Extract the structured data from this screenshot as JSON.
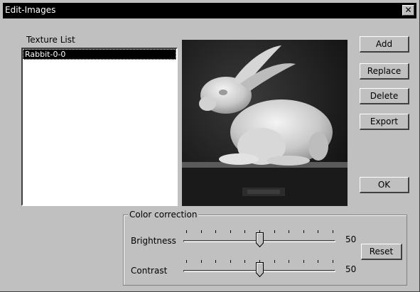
{
  "window": {
    "title": "Edit-Images",
    "close_label": "✕"
  },
  "texture_list": {
    "label": "Texture List",
    "items": [
      "Rabbit-0-0"
    ],
    "selected_index": 0
  },
  "buttons": {
    "add": "Add",
    "replace": "Replace",
    "delete": "Delete",
    "export": "Export",
    "ok": "OK",
    "reset": "Reset"
  },
  "color_correction": {
    "title": "Color correction",
    "brightness": {
      "label": "Brightness",
      "value": "50",
      "level": 0.5
    },
    "contrast": {
      "label": "Contrast",
      "value": "50",
      "level": 0.5
    }
  },
  "preview": {
    "icon": "rabbit-image"
  }
}
